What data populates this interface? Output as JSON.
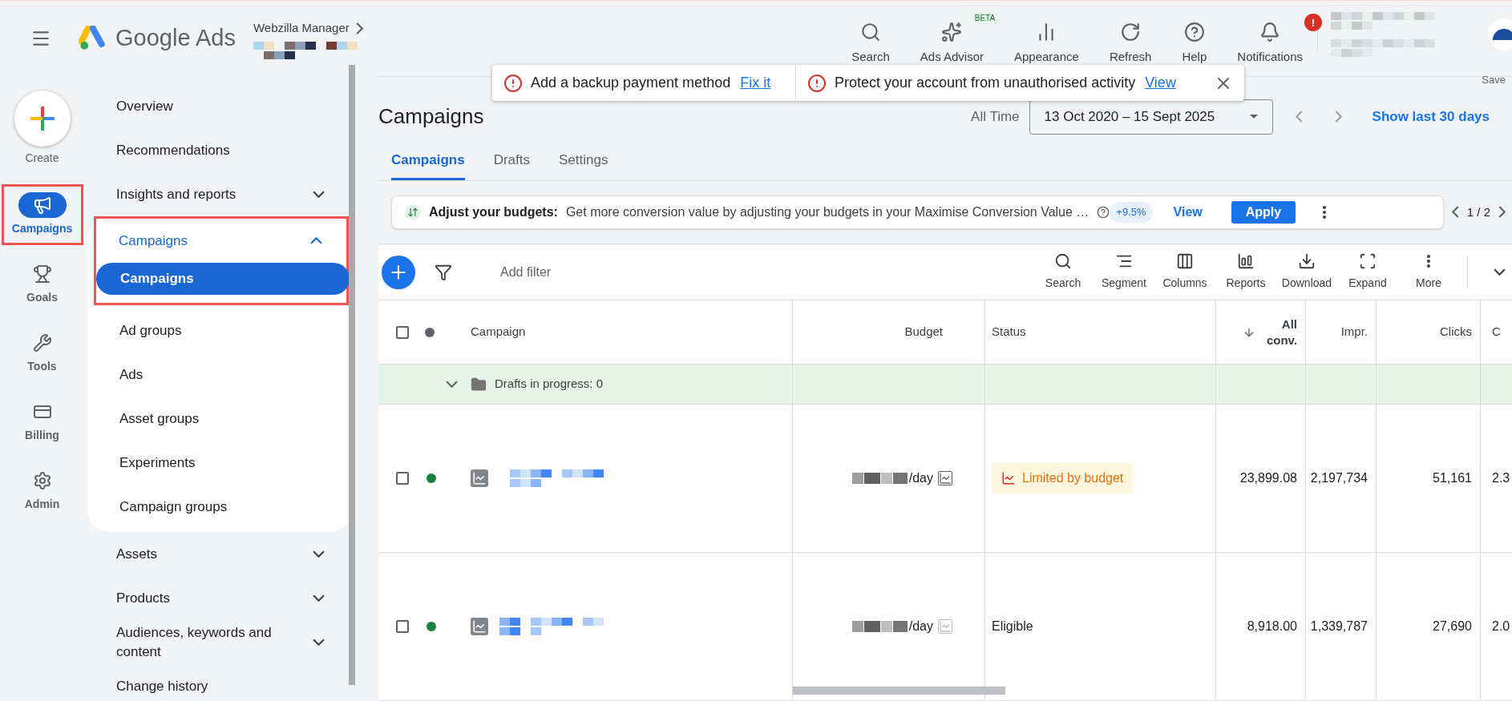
{
  "header": {
    "product": "Google Ads",
    "account": "Webzilla Manager",
    "tools": [
      {
        "kind": "search",
        "label": "Search"
      },
      {
        "kind": "advisor",
        "label": "Ads Advisor",
        "badge": "BETA"
      },
      {
        "kind": "appearance",
        "label": "Appearance"
      },
      {
        "kind": "refresh",
        "label": "Refresh"
      },
      {
        "kind": "help",
        "label": "Help"
      },
      {
        "kind": "bell",
        "label": "Notifications",
        "alert": "!"
      }
    ]
  },
  "alerts": [
    {
      "text": "Add a backup payment method",
      "link": "Fix it"
    },
    {
      "text": "Protect your account from unauthorised activity",
      "link": "View"
    }
  ],
  "save": "Save",
  "rail": {
    "create": "Create",
    "items": [
      {
        "kind": "campaigns",
        "label": "Campaigns",
        "selected": true,
        "highlighted": true
      },
      {
        "kind": "goals",
        "label": "Goals",
        "selected": false,
        "highlighted": false
      },
      {
        "kind": "tools",
        "label": "Tools",
        "selected": false,
        "highlighted": false
      },
      {
        "kind": "billing",
        "label": "Billing",
        "selected": false,
        "highlighted": false
      },
      {
        "kind": "admin",
        "label": "Admin",
        "selected": false,
        "highlighted": false
      }
    ]
  },
  "nav": [
    {
      "label": "Overview"
    },
    {
      "label": "Recommendations"
    },
    {
      "label": "Insights and reports",
      "expanded": false
    },
    {
      "label": "Campaigns",
      "expanded": true,
      "highlighted": true,
      "children": [
        {
          "label": "Campaigns",
          "selected": true
        },
        {
          "label": "Ad groups",
          "selected": false
        },
        {
          "label": "Ads",
          "selected": false
        },
        {
          "label": "Asset groups",
          "selected": false
        },
        {
          "label": "Experiments",
          "selected": false
        },
        {
          "label": "Campaign groups",
          "selected": false
        }
      ]
    },
    {
      "label": "Assets",
      "expanded": false
    },
    {
      "label": "Products",
      "expanded": false
    },
    {
      "label": "Audiences, keywords and content",
      "expanded": false
    },
    {
      "label": "Change history"
    }
  ],
  "page": {
    "title": "Campaigns",
    "range_label": "All Time",
    "date_range": "13 Oct 2020 – 15 Sept 2025",
    "show_last": "Show last 30 days"
  },
  "tabs": [
    {
      "label": "Campaigns",
      "selected": true
    },
    {
      "label": "Drafts",
      "selected": false
    },
    {
      "label": "Settings",
      "selected": false
    }
  ],
  "recommendation": {
    "title": "Adjust your budgets:",
    "text": "Get more conversion value by adjusting your budgets in your Maximise Conversion Value …",
    "chip": "+9.5%",
    "view": "View",
    "apply": "Apply",
    "pager": "1 / 2"
  },
  "toolbar": {
    "filter": "Add filter",
    "tools": [
      {
        "kind": "search",
        "label": "Search"
      },
      {
        "kind": "segment",
        "label": "Segment"
      },
      {
        "kind": "columns",
        "label": "Columns"
      },
      {
        "kind": "reports",
        "label": "Reports"
      },
      {
        "kind": "download",
        "label": "Download"
      },
      {
        "kind": "expand",
        "label": "Expand"
      },
      {
        "kind": "more",
        "label": "More"
      }
    ]
  },
  "table": {
    "columns": [
      "Campaign",
      "Budget",
      "Status",
      "All conv.",
      "Impr.",
      "Clicks",
      "C"
    ],
    "all_checked": false,
    "drafts": "Drafts in progress: 0",
    "rows": [
      {
        "checked": false,
        "color": "#188038",
        "budget": "/day",
        "budget_limited": true,
        "status": "Limited by budget",
        "kind": "limited",
        "all_conv": "23,899.08",
        "impr": "2,197,734",
        "clicks": "51,161",
        "column_8": "2.3"
      },
      {
        "checked": false,
        "color": "#188038",
        "budget": "/day",
        "budget_limited": false,
        "status": "Eligible",
        "kind": "plain",
        "all_conv": "8,918.00",
        "impr": "1,339,787",
        "clicks": "27,690",
        "column_8": "2.0"
      }
    ]
  }
}
